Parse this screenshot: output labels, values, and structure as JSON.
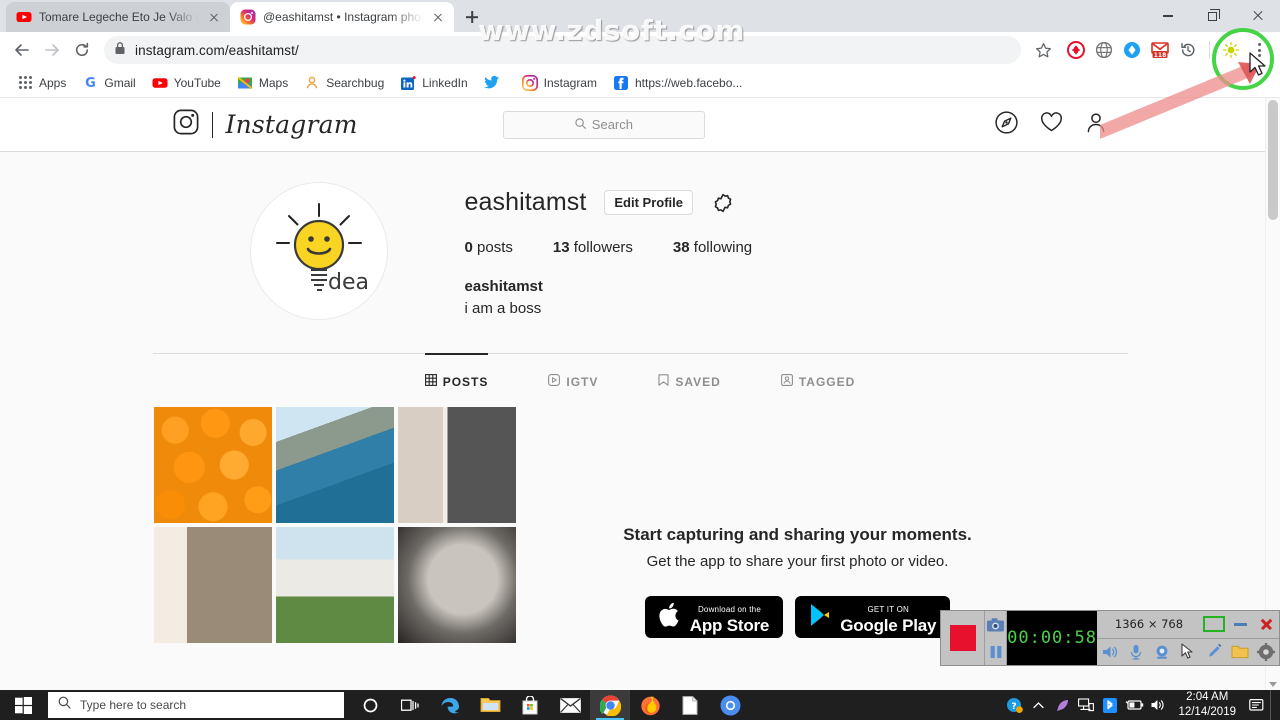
{
  "browser": {
    "tabs": [
      {
        "title": "Tomare Legeche Eto Je Valo ( Ne",
        "favicon": "youtube-icon",
        "active": false
      },
      {
        "title": "@eashitamst • Instagram photos",
        "favicon": "instagram-icon",
        "active": true
      }
    ],
    "new_tab_label": "+",
    "window_controls": {
      "minimize": "minimize-icon",
      "maximize": "restore-icon",
      "close": "close-icon"
    },
    "nav": {
      "back": "back-arrow-icon",
      "forward": "forward-arrow-icon",
      "reload": "reload-icon"
    },
    "omnibox": {
      "lock": "lock-icon",
      "url": "instagram.com/eashitamst/",
      "star": "bookmark-star-icon"
    },
    "extensions": [
      {
        "name": "adblock-extension-icon"
      },
      {
        "name": "globe-extension-icon"
      },
      {
        "name": "blue-diamond-extension-icon"
      },
      {
        "name": "gmail-checker-extension-icon",
        "badge": "118"
      },
      {
        "name": "history-extension-icon"
      },
      {
        "name": "lightbulb-extension-icon"
      }
    ],
    "menu": "chrome-menu-icon",
    "bookmarks": [
      {
        "label": "Apps",
        "icon": "apps-grid-icon"
      },
      {
        "label": "Gmail",
        "icon": "gmail-icon"
      },
      {
        "label": "YouTube",
        "icon": "youtube-icon"
      },
      {
        "label": "Maps",
        "icon": "maps-icon"
      },
      {
        "label": "Searchbug",
        "icon": "searchbug-icon"
      },
      {
        "label": "LinkedIn",
        "icon": "linkedin-icon"
      },
      {
        "label": "",
        "icon": "twitter-icon"
      },
      {
        "label": "Instagram",
        "icon": "instagram-icon"
      },
      {
        "label": "https://web.facebo...",
        "icon": "facebook-icon"
      }
    ]
  },
  "instagram": {
    "brand": "Instagram",
    "logo_icon": "instagram-camera-icon",
    "search": {
      "placeholder": "Search",
      "icon": "search-icon"
    },
    "nav_icons": [
      {
        "name": "explore-compass-icon"
      },
      {
        "name": "activity-heart-icon"
      },
      {
        "name": "profile-person-icon"
      }
    ],
    "profile": {
      "avatar_alt": "idea-lightbulb-avatar",
      "avatar_text": "dea",
      "username": "eashitamst",
      "edit_profile_label": "Edit Profile",
      "settings_icon": "gear-icon",
      "stats": [
        {
          "count": "0",
          "label": "posts"
        },
        {
          "count": "13",
          "label": "followers"
        },
        {
          "count": "38",
          "label": "following"
        }
      ],
      "full_name": "eashitamst",
      "bio": "i am a boss"
    },
    "tabs": [
      {
        "label": "POSTS",
        "icon": "grid-icon",
        "active": true
      },
      {
        "label": "IGTV",
        "icon": "igtv-icon",
        "active": false
      },
      {
        "label": "SAVED",
        "icon": "bookmark-icon",
        "active": false
      },
      {
        "label": "TAGGED",
        "icon": "tagged-person-icon",
        "active": false
      }
    ],
    "empty_state": {
      "title": "Start capturing and sharing your moments.",
      "subtitle": "Get the app to share your first photo or video.",
      "badges": [
        {
          "small": "Download on the",
          "large": "App Store",
          "icon": "apple-icon"
        },
        {
          "small": "GET IT ON",
          "large": "Google Play",
          "icon": "google-play-icon"
        }
      ]
    },
    "photos": [
      {
        "alt": "oranges-photo"
      },
      {
        "alt": "coastline-photo"
      },
      {
        "alt": "photobooth-strip-photo"
      },
      {
        "alt": "dog-photo"
      },
      {
        "alt": "cactus-building-photo"
      },
      {
        "alt": "baby-photo"
      }
    ]
  },
  "watermark": "www.zdsoft.com",
  "recorder": {
    "stop_label": "stop-button",
    "screenshot_icon": "camera-icon",
    "pause_icon": "pause-icon",
    "timer": "00:00:58",
    "resolution": "1366 × 768",
    "tools": [
      {
        "name": "speaker-icon"
      },
      {
        "name": "microphone-icon"
      },
      {
        "name": "webcam-icon"
      },
      {
        "name": "cursor-icon"
      },
      {
        "name": "pencil-icon"
      },
      {
        "name": "folder-icon"
      },
      {
        "name": "settings-gear-icon"
      }
    ],
    "region_icon": "region-select-icon",
    "minimize_icon": "minimize-icon",
    "close_icon": "close-icon"
  },
  "taskbar": {
    "start_icon": "windows-start-icon",
    "search_placeholder": "Type here to search",
    "search_icon": "search-icon",
    "cortana_icon": "cortana-circle-icon",
    "taskview_icon": "task-view-icon",
    "apps": [
      {
        "name": "edge-icon",
        "active": false
      },
      {
        "name": "file-explorer-icon",
        "active": false
      },
      {
        "name": "microsoft-store-icon",
        "active": false
      },
      {
        "name": "mail-icon",
        "active": false
      },
      {
        "name": "chrome-icon",
        "active": true
      },
      {
        "name": "firefox-icon",
        "active": false
      },
      {
        "name": "notepad-icon",
        "active": false
      },
      {
        "name": "chromium-icon",
        "active": false
      }
    ],
    "tray": [
      {
        "name": "help-question-icon"
      },
      {
        "name": "show-hidden-icons-chevron"
      },
      {
        "name": "feather-icon"
      },
      {
        "name": "network-icon"
      },
      {
        "name": "bluetooth-icon"
      },
      {
        "name": "battery-icon"
      },
      {
        "name": "volume-icon"
      }
    ],
    "time": "2:04 AM",
    "date": "12/14/2019",
    "notification_icon": "action-center-icon"
  },
  "colors": {
    "instagram_text": "#262626",
    "muted": "#8e8e8e",
    "chrome_bg": "#dee1e6",
    "accent_green": "#3bd23b",
    "accent_red": "#e8112d"
  }
}
